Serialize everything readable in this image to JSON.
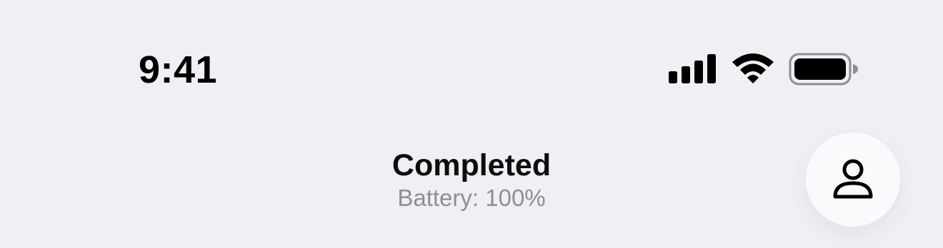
{
  "status_bar": {
    "time": "9:41",
    "signal_icon": "cellular-signal-icon",
    "wifi_icon": "wifi-icon",
    "battery_icon": "battery-icon",
    "battery_level": 100
  },
  "header": {
    "title": "Completed",
    "subtitle": "Battery: 100%",
    "profile_icon": "person-icon"
  },
  "colors": {
    "background": "#efeff4",
    "primary_text": "#0d0d0d",
    "secondary_text": "#8e8e93",
    "button_background": "#fafafd"
  }
}
